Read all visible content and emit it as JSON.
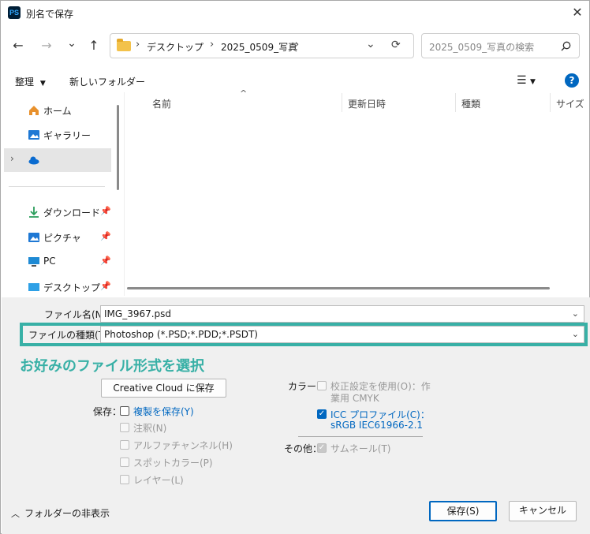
{
  "window": {
    "app_icon": "PS",
    "title": "別名で保存",
    "close": "✕"
  },
  "nav": {
    "back": "←",
    "forward": "→",
    "recent": "⌄",
    "up": "↑",
    "breadcrumb": [
      "デスクトップ",
      "2025_0509_写真"
    ],
    "refresh": "⟳",
    "search_placeholder": "2025_0509_写真の検索"
  },
  "toolbar": {
    "organize": "整理",
    "new_folder": "新しいフォルダー"
  },
  "sidebar": {
    "items": [
      {
        "label": "ホーム",
        "icon": "home-icon"
      },
      {
        "label": "ギャラリー",
        "icon": "gallery-icon"
      },
      {
        "label": "",
        "icon": "onedrive-icon"
      },
      {
        "label": "ダウンロード",
        "icon": "download-icon"
      },
      {
        "label": "ピクチャ",
        "icon": "pictures-icon"
      },
      {
        "label": "PC",
        "icon": "pc-icon"
      },
      {
        "label": "デスクトップ",
        "icon": "desktop-icon"
      }
    ]
  },
  "columns": [
    "名前",
    "更新日時",
    "種類",
    "サイズ"
  ],
  "form": {
    "filename_label": "ファイル名(N):",
    "filename_value": "IMG_3967.psd",
    "filetype_label": "ファイルの種類(T):",
    "filetype_value": "Photoshop (*.PSD;*.PDD;*.PSDT)"
  },
  "annotation": "お好みのファイル形式を選択",
  "options": {
    "cc_button": "Creative Cloud に保存",
    "save_label": "保存：",
    "save_items": [
      {
        "label": "複製を保存(Y)",
        "state": "active"
      },
      {
        "label": "注釈(N)",
        "state": "disabled"
      },
      {
        "label": "アルファチャンネル(H)",
        "state": "disabled"
      },
      {
        "label": "スポットカラー(P)",
        "state": "disabled"
      },
      {
        "label": "レイヤー(L)",
        "state": "disabled"
      }
    ],
    "color_label": "カラー：",
    "proof_line1": "校正設定を使用(O)：作",
    "proof_line2": "業用 CMYK",
    "icc_line1": "ICC プロファイル(C)：",
    "icc_line2": "sRGB IEC61966-2.1",
    "other_label": "その他：",
    "thumbnail": "サムネール(T)"
  },
  "footer": {
    "hide_folders": "フォルダーの非表示",
    "save": "保存(S)",
    "cancel": "キャンセル"
  },
  "colors": {
    "accent": "#0067c0",
    "highlight": "#38b0a6"
  }
}
